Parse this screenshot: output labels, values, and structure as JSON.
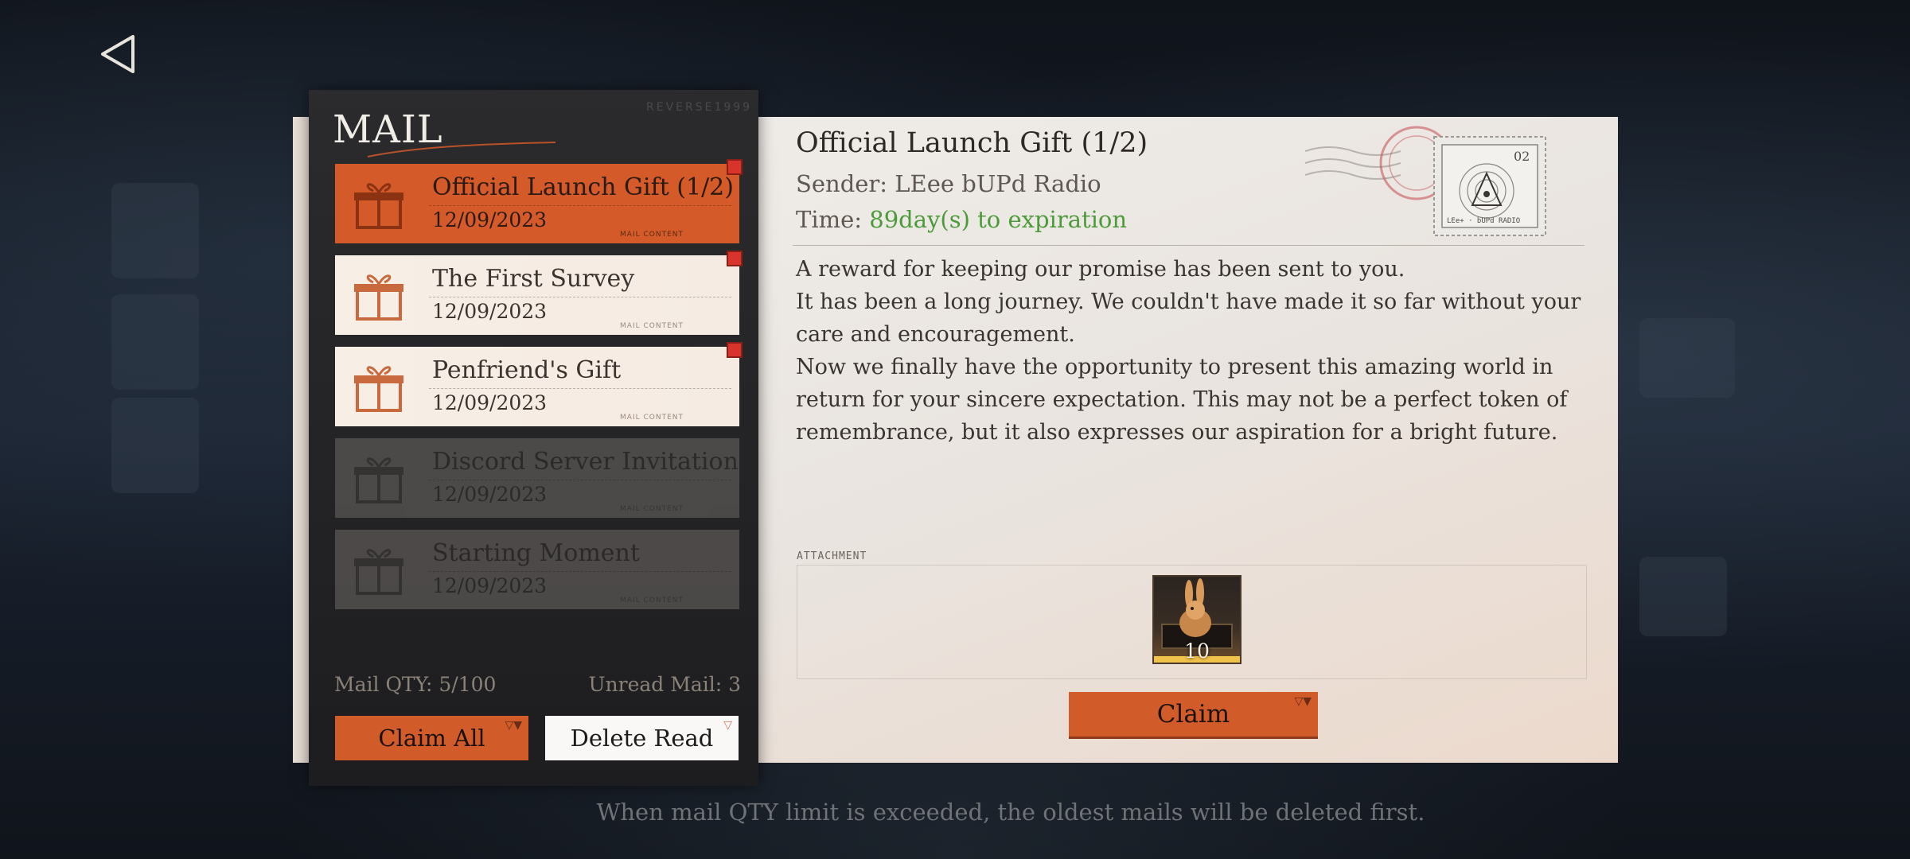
{
  "header": {
    "back_icon": "back-triangle-icon"
  },
  "mail_panel": {
    "title": "MAIL",
    "brand_mark": "REVERSE1999",
    "items": [
      {
        "subject": "Official Launch Gift (1/2)",
        "date": "12/09/2023",
        "tag": "MAIL CONTENT",
        "state": "active",
        "unread": true
      },
      {
        "subject": "The First Survey",
        "date": "12/09/2023",
        "tag": "MAIL CONTENT",
        "state": "unread",
        "unread": true
      },
      {
        "subject": "Penfriend's Gift",
        "date": "12/09/2023",
        "tag": "MAIL CONTENT",
        "state": "unread",
        "unread": true
      },
      {
        "subject": "Discord Server Invitation",
        "date": "12/09/2023",
        "tag": "MAIL CONTENT",
        "state": "read",
        "unread": false
      },
      {
        "subject": "Starting Moment",
        "date": "12/09/2023",
        "tag": "MAIL CONTENT",
        "state": "read",
        "unread": false
      }
    ],
    "qty_label": "Mail QTY: 5/100",
    "unread_label": "Unread Mail: 3",
    "claim_all_label": "Claim All",
    "delete_read_label": "Delete Read"
  },
  "detail": {
    "title": "Official Launch Gift (1/2)",
    "sender": "Sender: LEee bUPd Radio",
    "time_prefix": "Time: ",
    "time_value": "89day(s) to expiration",
    "body": [
      "A reward for keeping our promise has been sent to you.",
      "It has been a long journey. We couldn't have made it so far without your care and encouragement.",
      "Now we finally have the opportunity to present this amazing world in return for your sincere expectation. This may not be a perfect token of remembrance, but it also expresses our aspiration for a bright future."
    ],
    "stamp": {
      "number": "02",
      "footer": "LEe+ · bUPd RADIO"
    },
    "attachment_label": "ATTACHMENT",
    "attachment_qty": "10",
    "claim_label": "Claim"
  },
  "footer_note": "When mail QTY limit is exceeded, the oldest mails will be deleted first.",
  "colors": {
    "accent_orange": "#d25b2a",
    "expiration_green": "#4d9a3a",
    "unread_red": "#d9342b"
  }
}
